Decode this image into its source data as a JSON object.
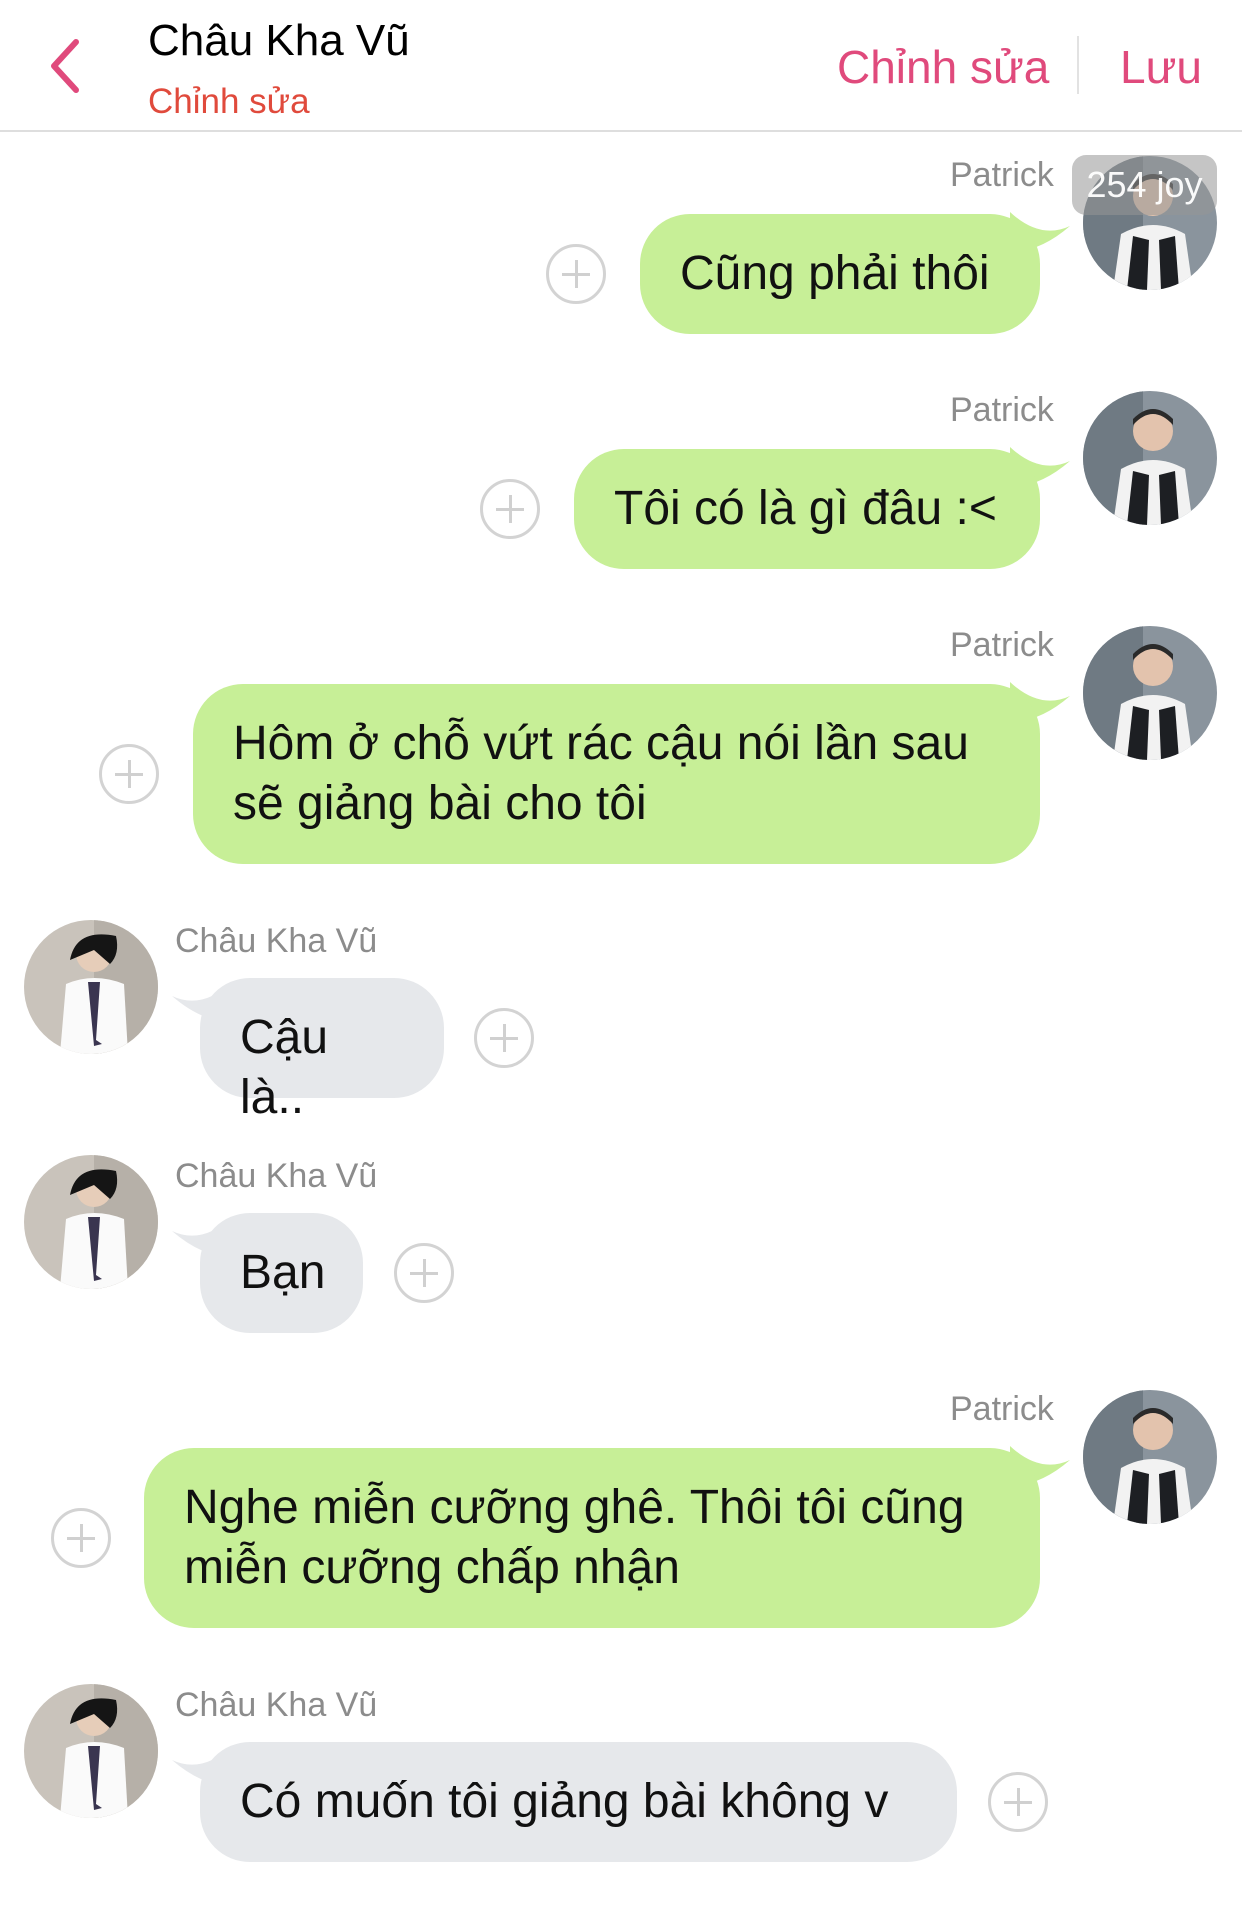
{
  "header": {
    "title": "Châu Kha Vũ",
    "subtitle": "Chỉnh sửa",
    "edit_label": "Chỉnh sửa",
    "save_label": "Lưu",
    "accent_color": "#e04a7c"
  },
  "watermark": "254 joy",
  "messages": [
    {
      "sender": "Patrick",
      "direction": "outgoing",
      "text": "Cũng phải thôi"
    },
    {
      "sender": "Patrick",
      "direction": "outgoing",
      "text": "Tôi có là gì đâu :<"
    },
    {
      "sender": "Patrick",
      "direction": "outgoing",
      "lines": [
        "Hôm ở chỗ vứt rác cậu nói lần sau",
        "sẽ giảng bài cho tôi"
      ]
    },
    {
      "sender": "Châu Kha Vũ",
      "direction": "incoming",
      "text": "Cậu là.."
    },
    {
      "sender": "Châu Kha Vũ",
      "direction": "incoming",
      "text": "Bạn"
    },
    {
      "sender": "Patrick",
      "direction": "outgoing",
      "lines": [
        "Nghe miễn cưỡng ghê. Thôi tôi cũng",
        "miễn cưỡng chấp nhận"
      ]
    },
    {
      "sender": "Châu Kha Vũ",
      "direction": "incoming",
      "text": "Có muốn tôi giảng bài không v"
    }
  ],
  "colors": {
    "outgoing_bubble": "#c7ef97",
    "incoming_bubble": "#e6e8eb"
  }
}
